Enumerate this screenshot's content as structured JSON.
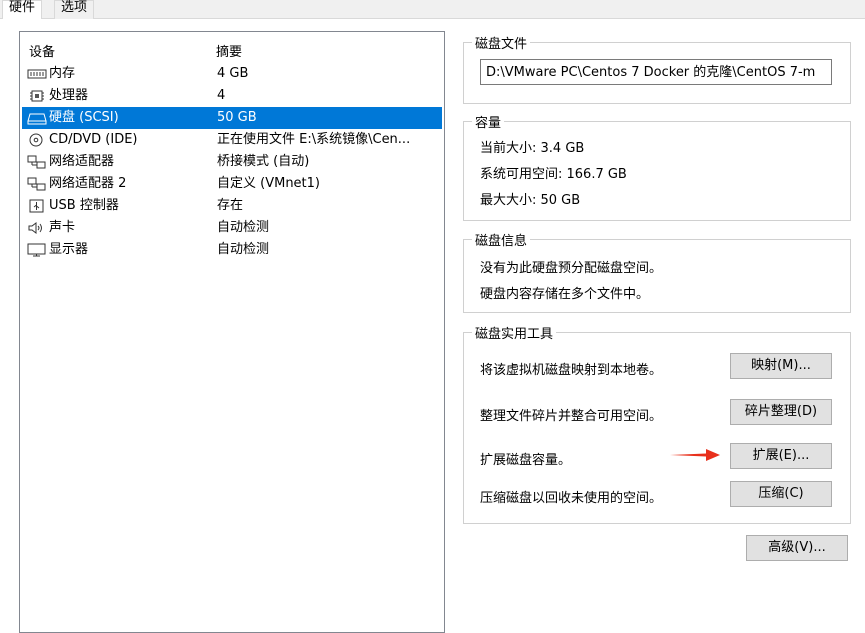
{
  "tabs": [
    "硬件",
    "选项"
  ],
  "device_list": {
    "col_device": "设备",
    "col_summary": "摘要",
    "rows": [
      {
        "name": "内存",
        "summary": "4 GB",
        "icon": "memory-icon",
        "selected": false
      },
      {
        "name": "处理器",
        "summary": "4",
        "icon": "cpu-icon",
        "selected": false
      },
      {
        "name": "硬盘 (SCSI)",
        "summary": "50 GB",
        "icon": "harddisk-icon",
        "selected": true
      },
      {
        "name": "CD/DVD (IDE)",
        "summary": "正在使用文件 E:\\系统镜像\\Cen...",
        "icon": "cd-dvd-icon",
        "selected": false
      },
      {
        "name": "网络适配器",
        "summary": "桥接模式 (自动)",
        "icon": "network-icon",
        "selected": false
      },
      {
        "name": "网络适配器 2",
        "summary": "自定义 (VMnet1)",
        "icon": "network-icon",
        "selected": false
      },
      {
        "name": "USB 控制器",
        "summary": "存在",
        "icon": "usb-icon",
        "selected": false
      },
      {
        "name": "声卡",
        "summary": "自动检测",
        "icon": "speaker-icon",
        "selected": false
      },
      {
        "name": "显示器",
        "summary": "自动检测",
        "icon": "monitor-icon",
        "selected": false
      }
    ]
  },
  "disk_file": {
    "legend": "磁盘文件",
    "path": "D:\\VMware PC\\Centos 7 Docker 的克隆\\CentOS 7-m"
  },
  "capacity": {
    "legend": "容量",
    "current": "当前大小: 3.4 GB",
    "available": "系统可用空间: 166.7 GB",
    "max": "最大大小: 50 GB"
  },
  "disk_info": {
    "legend": "磁盘信息",
    "line1": "没有为此硬盘预分配磁盘空间。",
    "line2": "硬盘内容存储在多个文件中。"
  },
  "utilities": {
    "legend": "磁盘实用工具",
    "map_desc": "将该虚拟机磁盘映射到本地卷。",
    "map_btn": "映射(M)...",
    "defrag_desc": "整理文件碎片并整合可用空间。",
    "defrag_btn": "碎片整理(D)",
    "expand_desc": "扩展磁盘容量。",
    "expand_btn": "扩展(E)...",
    "compact_desc": "压缩磁盘以回收未使用的空间。",
    "compact_btn": "压缩(C)"
  },
  "advanced_btn": "高级(V)...",
  "colors": {
    "selection": "#0078d7",
    "arrow": "#e8301c"
  }
}
